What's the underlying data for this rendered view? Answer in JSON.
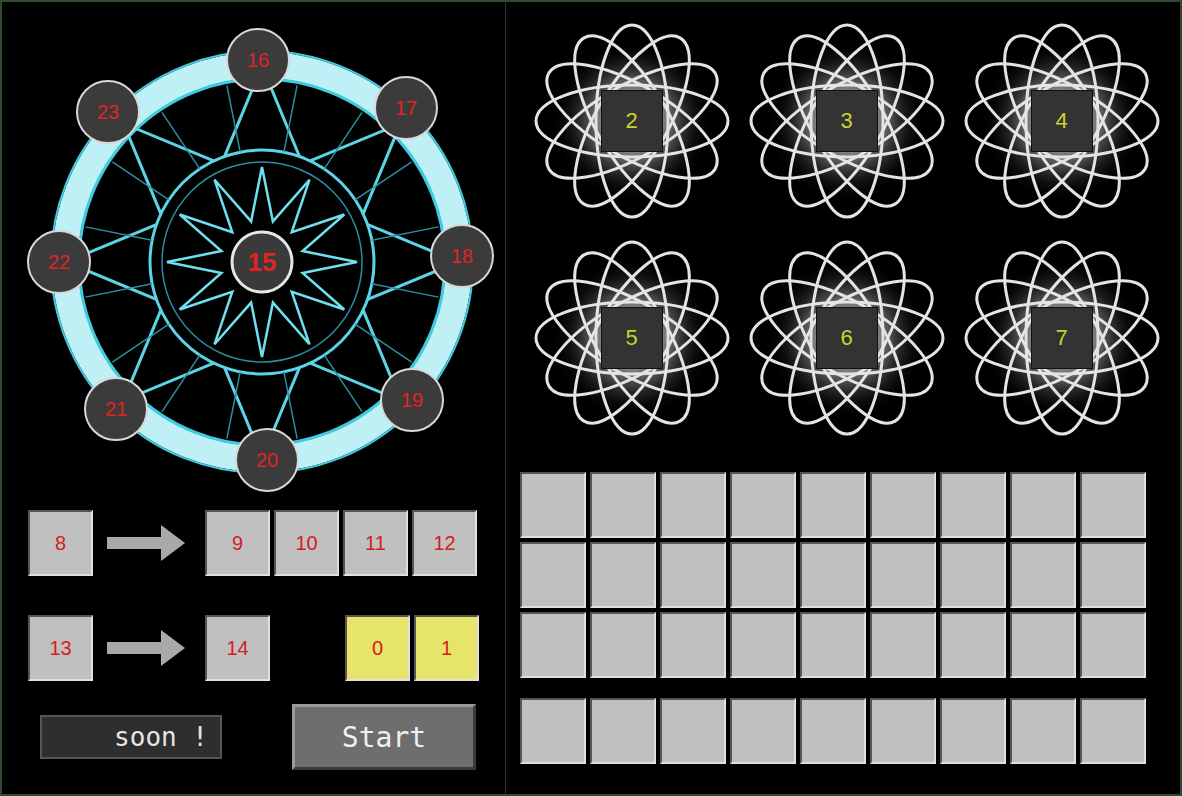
{
  "magic_circle": {
    "center": {
      "label": "15"
    },
    "nodes": [
      {
        "label": "16"
      },
      {
        "label": "17"
      },
      {
        "label": "18"
      },
      {
        "label": "19"
      },
      {
        "label": "20"
      },
      {
        "label": "21"
      },
      {
        "label": "22"
      },
      {
        "label": "23"
      }
    ]
  },
  "atoms": [
    {
      "label": "2"
    },
    {
      "label": "3"
    },
    {
      "label": "4"
    },
    {
      "label": "5"
    },
    {
      "label": "6"
    },
    {
      "label": "7"
    }
  ],
  "recipes": [
    {
      "inputs": [
        {
          "label": "8",
          "highlighted": false
        }
      ],
      "outputs": [
        {
          "label": "9",
          "highlighted": false
        },
        {
          "label": "10",
          "highlighted": false
        },
        {
          "label": "11",
          "highlighted": false
        },
        {
          "label": "12",
          "highlighted": false
        }
      ]
    },
    {
      "inputs": [
        {
          "label": "13",
          "highlighted": false
        }
      ],
      "outputs": [
        {
          "label": "14",
          "highlighted": false
        }
      ]
    }
  ],
  "extra_slots": [
    {
      "label": "0",
      "highlighted": true
    },
    {
      "label": "1",
      "highlighted": true
    }
  ],
  "soon_label": "soon !",
  "start_button": {
    "label": "Start"
  },
  "inventory": {
    "slots": [
      {
        "filled": false
      },
      {
        "filled": false
      },
      {
        "filled": false
      },
      {
        "filled": false
      },
      {
        "filled": false
      },
      {
        "filled": false
      },
      {
        "filled": false
      },
      {
        "filled": false
      },
      {
        "filled": false
      },
      {
        "filled": false
      },
      {
        "filled": false
      },
      {
        "filled": false
      },
      {
        "filled": false
      },
      {
        "filled": false
      },
      {
        "filled": false
      },
      {
        "filled": false
      },
      {
        "filled": false
      },
      {
        "filled": false
      },
      {
        "filled": false
      },
      {
        "filled": false
      },
      {
        "filled": false
      },
      {
        "filled": false
      },
      {
        "filled": false
      },
      {
        "filled": false
      },
      {
        "filled": false
      },
      {
        "filled": false
      },
      {
        "filled": false
      }
    ],
    "hotbar": [
      {
        "filled": false
      },
      {
        "filled": false
      },
      {
        "filled": false
      },
      {
        "filled": false
      },
      {
        "filled": false
      },
      {
        "filled": false
      },
      {
        "filled": false
      },
      {
        "filled": false
      },
      {
        "filled": false
      }
    ]
  }
}
